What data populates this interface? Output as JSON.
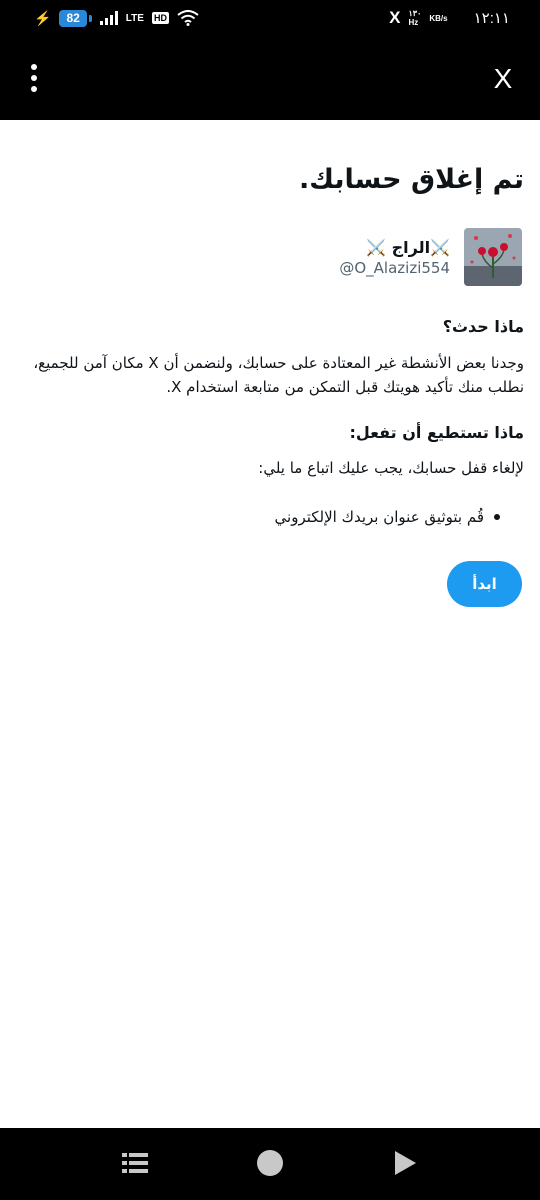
{
  "status_bar": {
    "battery_level": "82",
    "network": "LTE",
    "hd_badge": "HD",
    "x_label": "X",
    "speed_value": "١٣٠",
    "speed_unit_hz": "Hz",
    "speed_unit": "KB/s",
    "time": "١٢:١١"
  },
  "header": {
    "menu_icon": "more-vertical-icon",
    "close_label": "X"
  },
  "page": {
    "title": "تم إغلاق حسابك."
  },
  "account": {
    "display_name": "⚔️الراج ⚔️",
    "username": "@O_Alazizi554"
  },
  "what_happened": {
    "title": "ماذا حدث؟",
    "body": "وجدنا بعض الأنشطة غير المعتادة على حسابك، ولنضمن أن X مكان آمن للجميع، نطلب منك تأكيد هويتك قبل التمكن من متابعة استخدام X."
  },
  "what_to_do": {
    "title": "ماذا تستطيع أن تفعل:",
    "body": "لإلغاء قفل حسابك، يجب عليك اتباع ما يلي:",
    "steps": [
      "قُم بتوثيق عنوان بريدك الإلكتروني"
    ]
  },
  "actions": {
    "start_label": "ابدأ"
  },
  "colors": {
    "accent": "#1d9bf0",
    "text": "#0f1419",
    "secondary_text": "#536471",
    "chrome": "#000000"
  }
}
